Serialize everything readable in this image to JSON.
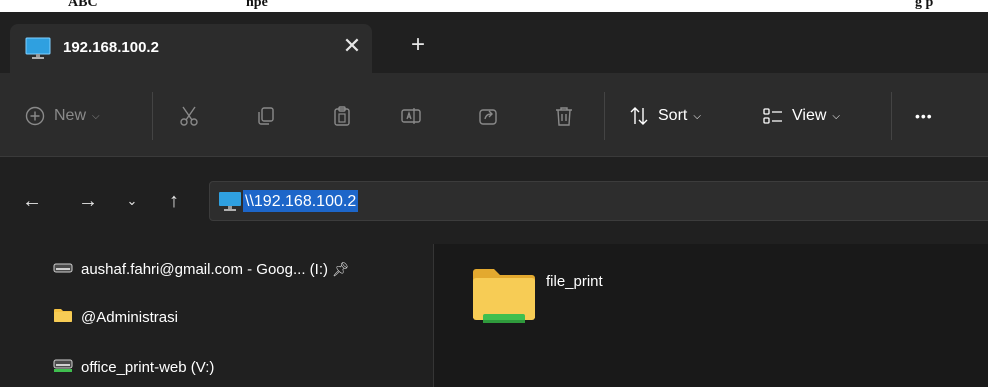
{
  "background_text": [
    "ABC",
    "npe",
    "g p"
  ],
  "tab": {
    "title": "192.168.100.2",
    "close_glyph": "✕",
    "new_tab_glyph": "+"
  },
  "toolbar": {
    "new_label": "New",
    "sort_label": "Sort",
    "view_label": "View",
    "more_glyph": "•••"
  },
  "nav": {
    "back": "←",
    "forward": "→",
    "recent": "⌄",
    "up": "↑"
  },
  "address": {
    "path": "\\\\192.168.100.2"
  },
  "sidebar": {
    "items": [
      {
        "label": "aushaf.fahri@gmail.com - Goog... (I:)",
        "icon": "drive-icon",
        "pinned": true
      },
      {
        "label": "@Administrasi",
        "icon": "folder-icon"
      },
      {
        "label": "office_print-web (V:)",
        "icon": "network-drive-icon"
      }
    ]
  },
  "content": {
    "folders": [
      {
        "label": "file_print",
        "icon": "shared-folder-icon"
      }
    ]
  },
  "colors": {
    "accent": "#1d66c9",
    "folder": "#f5c242",
    "share_bar": "#3fbf4f",
    "monitor": "#2fa0e0"
  }
}
